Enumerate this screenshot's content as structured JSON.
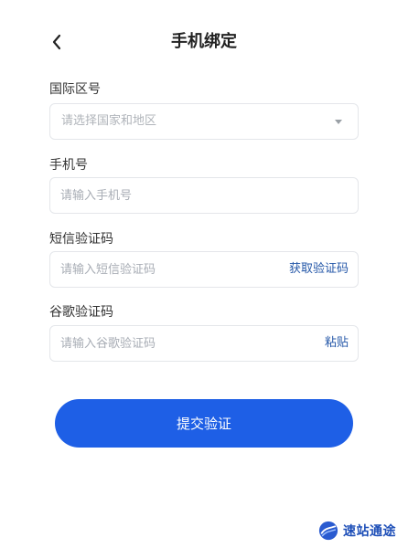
{
  "header": {
    "title": "手机绑定",
    "back_icon": "chevron-left-icon"
  },
  "form": {
    "region": {
      "label": "国际区号",
      "placeholder": "请选择国家和地区",
      "icon": "dropdown-caret-icon"
    },
    "phone": {
      "label": "手机号",
      "placeholder": "请输入手机号"
    },
    "sms_code": {
      "label": "短信验证码",
      "placeholder": "请输入短信验证码",
      "action": "获取验证码"
    },
    "google_code": {
      "label": "谷歌验证码",
      "placeholder": "请输入谷歌验证码",
      "action": "粘贴"
    },
    "submit_label": "提交验证"
  },
  "watermark": {
    "text": "速站通途",
    "icon": "watermark-logo-icon"
  },
  "colors": {
    "primary": "#1e5fe6",
    "link": "#2457a8",
    "border": "#e4e6ea",
    "placeholder": "#a8adb5"
  }
}
